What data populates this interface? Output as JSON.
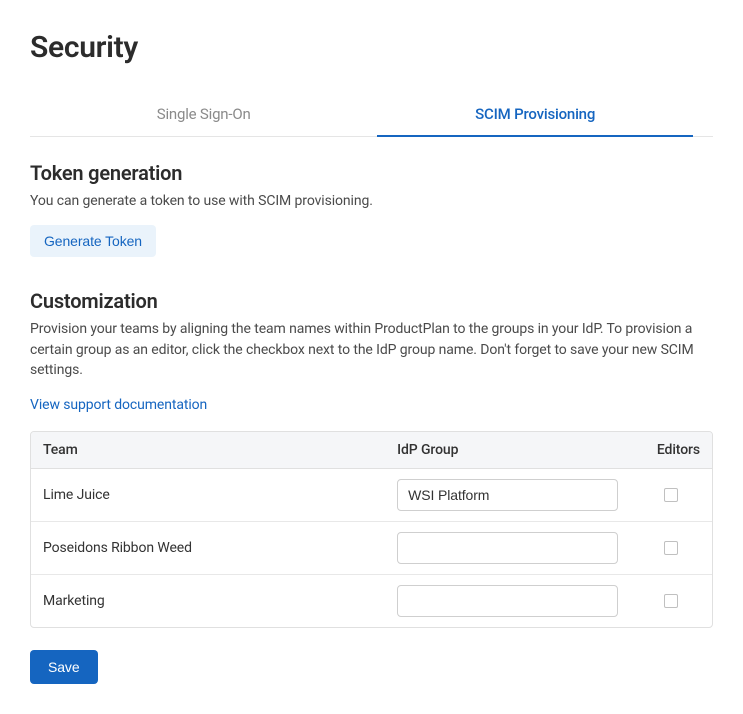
{
  "page": {
    "title": "Security"
  },
  "tabs": [
    {
      "label": "Single Sign-On"
    },
    {
      "label": "SCIM Provisioning"
    }
  ],
  "token_section": {
    "title": "Token generation",
    "desc": "You can generate a token to use with SCIM provisioning.",
    "button": "Generate Token"
  },
  "custom_section": {
    "title": "Customization",
    "desc": "Provision your teams by aligning the team names within ProductPlan to the groups in your IdP.  To provision a certain group as an editor, click the checkbox next to the IdP group name. Don't forget to save your new SCIM settings.",
    "link": "View support documentation"
  },
  "table": {
    "headers": {
      "team": "Team",
      "idp": "IdP Group",
      "editors": "Editors"
    },
    "rows": [
      {
        "team": "Lime Juice",
        "idp": "WSI Platform"
      },
      {
        "team": "Poseidons Ribbon Weed",
        "idp": ""
      },
      {
        "team": "Marketing",
        "idp": ""
      }
    ]
  },
  "save_button": "Save"
}
